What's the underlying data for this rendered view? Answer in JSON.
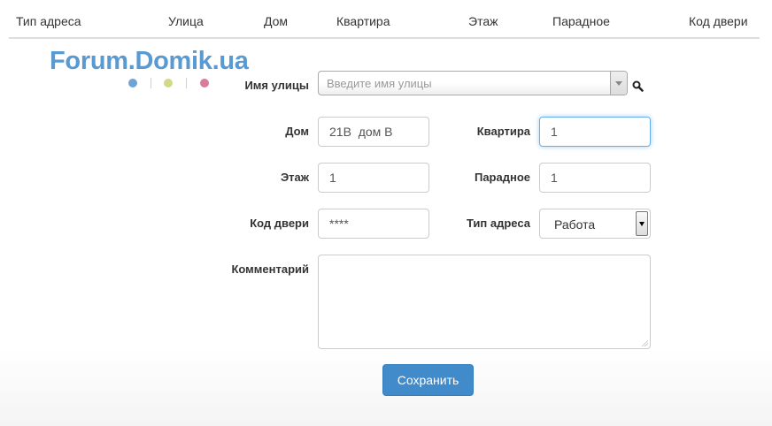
{
  "header": {
    "columns": [
      "Тип адреса",
      "Улица",
      "Дом",
      "Квартира",
      "Этаж",
      "Парадное",
      "Код двери"
    ]
  },
  "logo": {
    "text": "Forum.Domik.ua",
    "color": "#5a9ad3",
    "dot_colors": [
      "#6fa3d8",
      "#d4d98a",
      "#d97b9a"
    ]
  },
  "form": {
    "street": {
      "label": "Имя улицы",
      "placeholder": "Введите имя улицы"
    },
    "house": {
      "label": "Дом",
      "value": "21В  дом В"
    },
    "apartment": {
      "label": "Квартира",
      "value": "1"
    },
    "floor": {
      "label": "Этаж",
      "value": "1"
    },
    "entrance": {
      "label": "Парадное",
      "value": "1"
    },
    "door_code": {
      "label": "Код двери",
      "value": "****"
    },
    "address_type": {
      "label": "Тип адреса",
      "selected": "Работа"
    },
    "comment": {
      "label": "Комментарий",
      "value": ""
    },
    "save_label": "Сохранить"
  },
  "colors": {
    "primary_button": "#428bca",
    "focus_border": "#66afe9"
  }
}
